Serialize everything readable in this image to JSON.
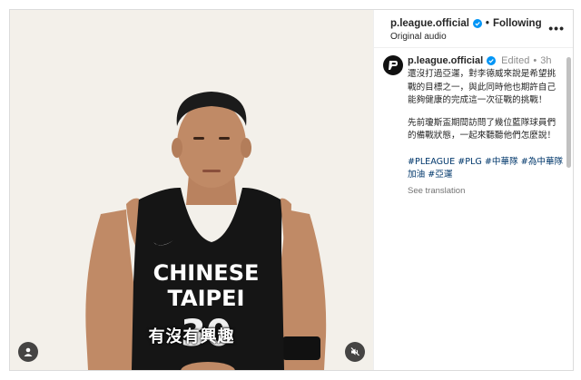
{
  "video": {
    "subtitle": "有沒有興趣",
    "jersey_line1": "CHINESE",
    "jersey_line2": "TAIPEI",
    "jersey_number": "30"
  },
  "header": {
    "username": "p.league.official",
    "following_label": "Following",
    "audio_label": "Original audio",
    "more_icon": "more-horizontal-icon"
  },
  "post": {
    "username": "p.league.official",
    "edited_label": "Edited",
    "time_label": "3h",
    "caption_p1": "還沒打過亞運，對李德威來說是希望挑戰的目標之一，與此同時他也期許自己能夠健康的完成這一次征戰的挑戰！",
    "caption_p2": "先前瓊斯盃期間訪問了幾位藍隊球員們的備戰狀態，一起來聽聽他們怎麼說！",
    "hashtags": "#PLEAGUE #PLG #中華隊 #為中華隊加油 #亞運",
    "see_translation": "See translation"
  },
  "colors": {
    "verified": "#0095f6",
    "hashtag": "#00376b",
    "muted": "#8e8e8e",
    "jersey": "#151515",
    "skin": "#c08a66"
  }
}
